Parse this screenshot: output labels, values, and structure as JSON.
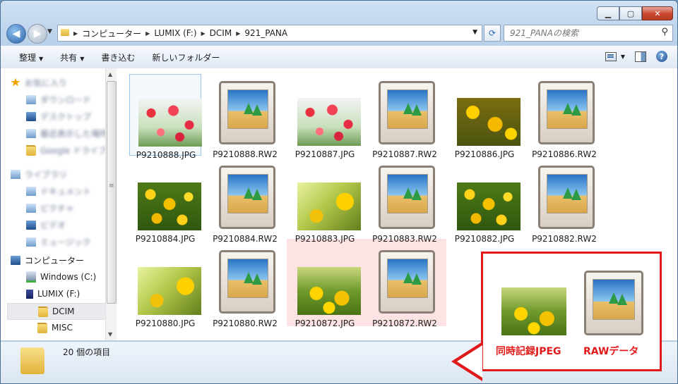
{
  "address": {
    "segments": [
      "コンピューター",
      "LUMIX (F:)",
      "DCIM",
      "921_PANA"
    ]
  },
  "search": {
    "placeholder": "921_PANAの検索"
  },
  "toolbar": {
    "organize": "整理",
    "share": "共有",
    "burn": "書き込む",
    "new_folder": "新しいフォルダー"
  },
  "nav": {
    "items": [
      "お気に入り",
      "ダウンロード",
      "デスクトップ",
      "最近表示した場所",
      "Google ドライブ",
      "ライブラリ",
      "ドキュメント",
      "ピクチャ",
      "ビデオ",
      "ミュージック"
    ],
    "computer": "コンピューター",
    "windows": "Windows (C:)",
    "lumix": "LUMIX (F:)",
    "dcim": "DCIM",
    "misc": "MISC"
  },
  "files": [
    {
      "name": "P9210888.JPG",
      "kind": "red"
    },
    {
      "name": "P9210888.RW2",
      "kind": "raw"
    },
    {
      "name": "P9210887.JPG",
      "kind": "red"
    },
    {
      "name": "P9210887.RW2",
      "kind": "raw"
    },
    {
      "name": "P9210886.JPG",
      "kind": "yel4"
    },
    {
      "name": "P9210886.RW2",
      "kind": "raw"
    },
    {
      "name": "P9210884.JPG",
      "kind": "yel"
    },
    {
      "name": "P9210884.RW2",
      "kind": "raw"
    },
    {
      "name": "P9210883.JPG",
      "kind": "yel3"
    },
    {
      "name": "P9210883.RW2",
      "kind": "raw"
    },
    {
      "name": "P9210882.JPG",
      "kind": "yel"
    },
    {
      "name": "P9210882.RW2",
      "kind": "raw"
    },
    {
      "name": "P9210880.JPG",
      "kind": "yel3"
    },
    {
      "name": "P9210880.RW2",
      "kind": "raw"
    },
    {
      "name": "P9210872.JPG",
      "kind": "yel2"
    },
    {
      "name": "P9210872.RW2",
      "kind": "raw"
    }
  ],
  "status": {
    "count": "20 個の項目"
  },
  "callout": {
    "jpeg_label": "同時記録JPEG",
    "raw_label": "RAWデータ"
  },
  "colors": {
    "annotation": "#e01a1a",
    "highlight": "#fde3e3"
  }
}
